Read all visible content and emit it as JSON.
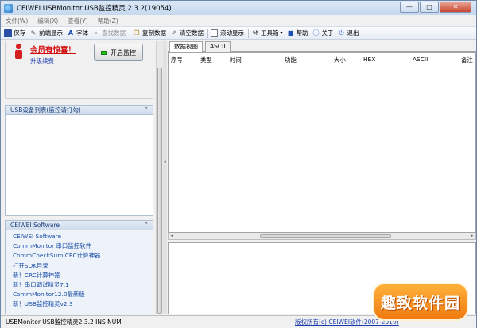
{
  "window": {
    "title": "CEIWEI USBMonitor USB监控精灵 2.3.2(19054)",
    "minimize": "—",
    "maximize": "□",
    "close": "✕"
  },
  "menu": [
    "文件(W)",
    "编辑(X)",
    "查看(Y)",
    "帮助(Z)"
  ],
  "toolbar": {
    "save": "保存",
    "front_display": "前端显示",
    "font": "字体",
    "find": "查找数据",
    "copy": "复制数据",
    "clear": "清空数据",
    "scroll": "滚动显示",
    "tools": "工具箱",
    "help": "帮助",
    "about": "关于",
    "exit": "退出"
  },
  "promo": {
    "title": "会员有惊喜！",
    "link": "升级续费",
    "start_button": "开启监控"
  },
  "usb_panel": {
    "header": "USB设备列表(监控请打勾)"
  },
  "software_panel": {
    "header": "CEIWEI Software",
    "links": [
      "CEIWEI Software",
      "CommMonitor 串口监控软件",
      "CommCheckSum CRC计算神器",
      "打开SDK目录",
      "新！CRC计算神器",
      "新！串口调试精灵7.1",
      "CommMonitor12.0最新版",
      "新！USB监控精灵v2.3"
    ]
  },
  "tabs": [
    "数据视图",
    "ASCII"
  ],
  "columns": [
    "序号",
    "类型",
    "时间",
    "功能",
    "大小",
    "HEX",
    "ASCII",
    "备注"
  ],
  "statusbar": {
    "left": "USBMonitor USB监控精灵2.3.2   INS   NUM",
    "copyright": "版权所有(c) CEIWEI软件(2007-2019)"
  },
  "watermark": "趣致软件园",
  "colors": {
    "promo_red": "#d30a0a",
    "link_blue": "#1a4ea8",
    "led_green": "#22c31b",
    "watermark_orange": "#f07a10"
  }
}
